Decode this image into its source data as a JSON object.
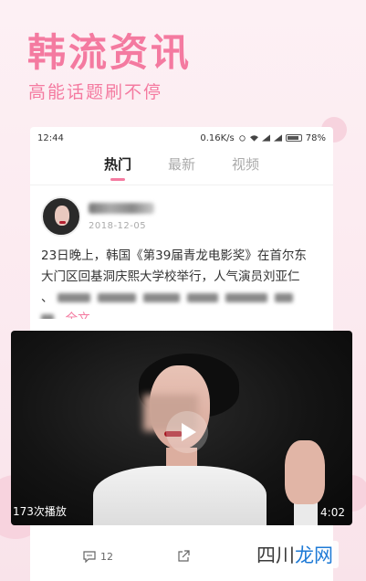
{
  "promo": {
    "title": "韩流资讯",
    "subtitle": "高能话题刷不停"
  },
  "status_bar": {
    "time": "12:44",
    "network_speed": "0.16K/s",
    "battery": "78%"
  },
  "tabs": [
    {
      "label": "热门",
      "active": true
    },
    {
      "label": "最新",
      "active": false
    },
    {
      "label": "视频",
      "active": false
    }
  ],
  "post": {
    "date": "2018-12-05",
    "text_line1": "23日晚上，韩国《第39届青龙电影奖》在首尔东",
    "text_line2": "大门区回基洞庆熙大学校举行，人气演员刘亚仁",
    "text_line3": "、",
    "more_label": "..全文"
  },
  "video": {
    "views": "173次播放",
    "duration": "4:02"
  },
  "actions": {
    "comment_count": "12"
  },
  "watermark": {
    "part1": "四川",
    "part2": "龙网"
  },
  "colors": {
    "accent": "#f47aa0",
    "background": "#fbeef2"
  }
}
